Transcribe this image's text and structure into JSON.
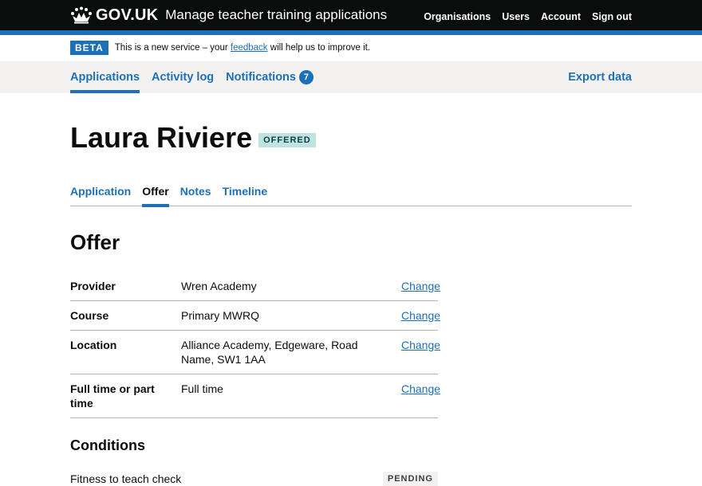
{
  "header": {
    "logo_text": "GOV.UK",
    "service_name": "Manage teacher training applications",
    "nav": [
      "Organisations",
      "Users",
      "Account",
      "Sign out"
    ]
  },
  "phase_banner": {
    "tag": "BETA",
    "text_before": "This is a new service – your ",
    "link": "feedback",
    "text_after": " will help us to improve it."
  },
  "primary_nav": {
    "items": [
      "Applications",
      "Activity log",
      "Notifications"
    ],
    "notifications_count": "7",
    "export": "Export data"
  },
  "candidate": {
    "name": "Laura Riviere",
    "status": "OFFERED"
  },
  "sub_nav": [
    "Application",
    "Offer",
    "Notes",
    "Timeline"
  ],
  "offer": {
    "title": "Offer",
    "rows": [
      {
        "key": "Provider",
        "value": "Wren Academy",
        "action": "Change"
      },
      {
        "key": "Course",
        "value": "Primary MWRQ",
        "action": "Change"
      },
      {
        "key": "Location",
        "value": "Alliance Academy, Edgeware, Road Name, SW1 1AA",
        "action": "Change"
      },
      {
        "key": "Full time or part time",
        "value": "Full time",
        "action": "Change"
      }
    ]
  },
  "conditions": {
    "title": "Conditions",
    "items": [
      {
        "text": "Fitness to teach check",
        "status": "PENDING"
      }
    ]
  },
  "colors": {
    "header_bg": "#0b0c0c",
    "brand_blue": "#1d70b8",
    "nav_bg": "#f3f2f1",
    "offered_tag_bg": "#bfe3e0",
    "offered_tag_text": "#10403c"
  }
}
